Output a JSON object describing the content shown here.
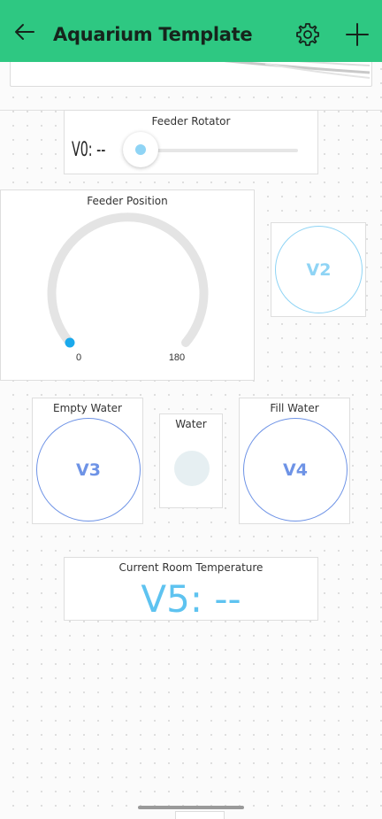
{
  "header": {
    "title": "Aquarium Template"
  },
  "feeder_rotator": {
    "label": "Feeder Rotator",
    "value_text": "V0: --"
  },
  "feeder_position": {
    "label": "Feeder Position",
    "min_label": "0",
    "max_label": "180"
  },
  "button_v2": {
    "label": "V2"
  },
  "empty_water": {
    "label": "Empty Water",
    "button_label": "V3"
  },
  "water": {
    "label": "Water"
  },
  "fill_water": {
    "label": "Fill Water",
    "button_label": "V4"
  },
  "room_temperature": {
    "label": "Current Room Temperature",
    "value_text": "V5: --"
  },
  "colors": {
    "header_bg": "#2ec882",
    "accent_blue": "#5ec3f0",
    "button_outline_blue": "#6e93e6",
    "led_off": "#e6eff2"
  }
}
